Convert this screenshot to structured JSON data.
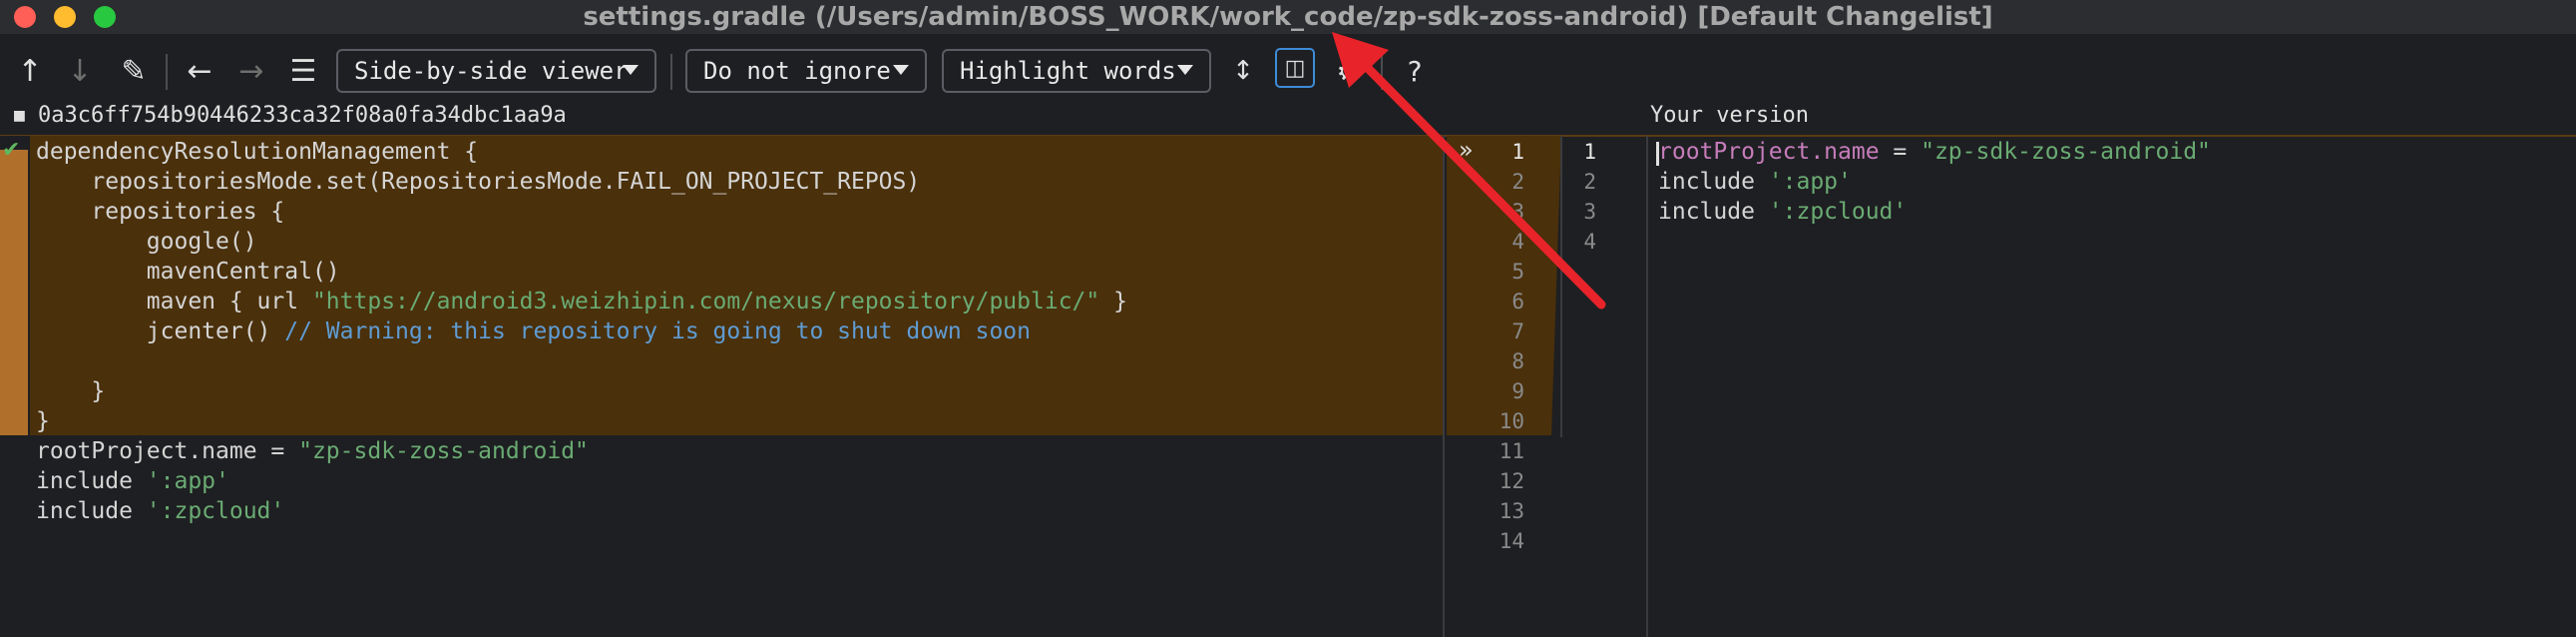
{
  "window": {
    "title": "settings.gradle (/Users/admin/BOSS_WORK/work_code/zp-sdk-zoss-android) [Default Changelist]",
    "traffic_colors": {
      "close": "#ff5f57",
      "minimize": "#febc2e",
      "zoom": "#28c840"
    }
  },
  "toolbar": {
    "viewer_select": "Side-by-side viewer",
    "ignore_select": "Do not ignore",
    "highlight_select": "Highlight words",
    "help_label": "?"
  },
  "left_pane": {
    "revision": "0a3c6ff754b90446233ca32f08a0fa34dbc1aa9a",
    "lines": [
      {
        "t": "dependencyResolutionManagement {"
      },
      {
        "t": "    repositoriesMode.set(RepositoriesMode.FAIL_ON_PROJECT_REPOS)"
      },
      {
        "t": "    repositories {"
      },
      {
        "t": "        google()"
      },
      {
        "t": "        mavenCentral()"
      },
      {
        "pre": "        maven { url ",
        "str": "\"https://android3.weizhipin.com/nexus/repository/public/\"",
        "post": " }"
      },
      {
        "pre": "        jcenter() ",
        "cmt": "// Warning: this repository is going to shut down soon"
      },
      {
        "t": ""
      },
      {
        "t": "    }"
      },
      {
        "t": "}"
      },
      {
        "pre": "rootProject.name = ",
        "str": "\"zp-sdk-zoss-android\""
      },
      {
        "pre": "include ",
        "str": "':app'"
      },
      {
        "pre": "include ",
        "str": "':zpcloud'"
      },
      {
        "t": ""
      }
    ],
    "line_numbers": [
      "1",
      "2",
      "3",
      "4",
      "5",
      "6",
      "7",
      "8",
      "9",
      "10",
      "11",
      "12",
      "13",
      "14"
    ]
  },
  "right_pane": {
    "header": "Your version",
    "line_numbers": [
      "1",
      "2",
      "3",
      "4"
    ],
    "lines": [
      {
        "prop": "rootProject.name",
        "pre": " = ",
        "str": "\"zp-sdk-zoss-android\""
      },
      {
        "pre": "include ",
        "str": "':app'"
      },
      {
        "pre": "include ",
        "str": "':zpcloud'"
      },
      {
        "t": ""
      }
    ]
  },
  "colors": {
    "change_bg": "#4a300b",
    "gutter_change": "#b06f2a",
    "string": "#6aab73",
    "comment": "#5f9cd3",
    "annotation_arrow": "#e8232a"
  }
}
